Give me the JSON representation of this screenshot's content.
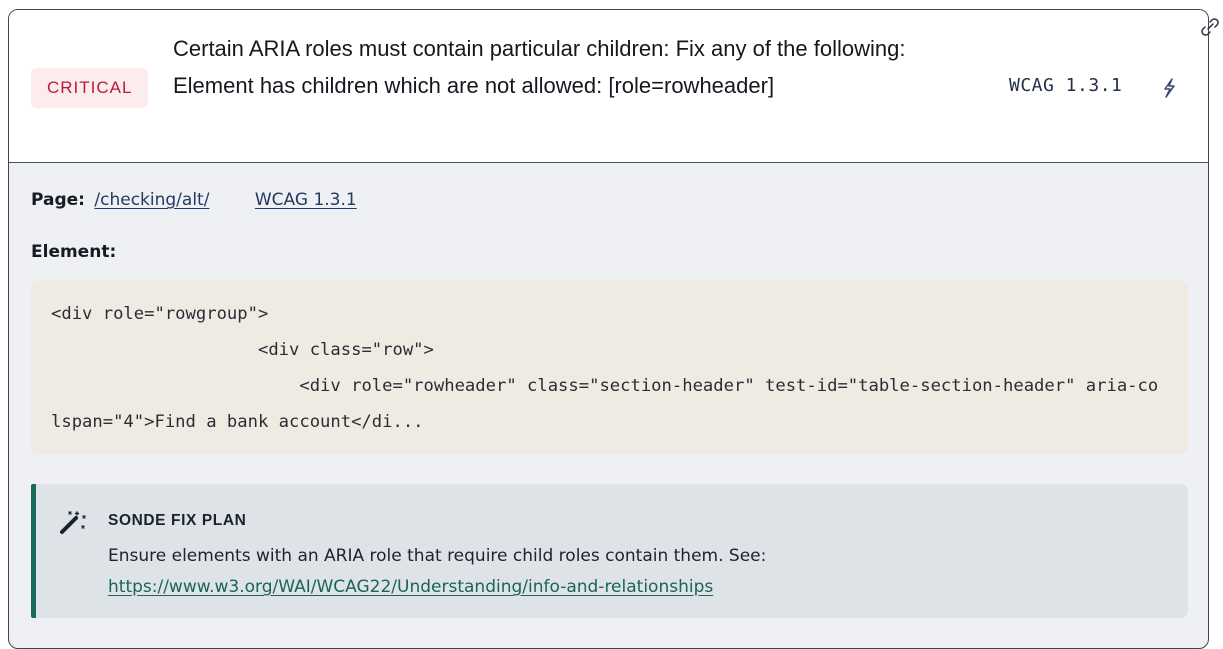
{
  "issue": {
    "severity": "CRITICAL",
    "title": "Certain ARIA roles must contain particular children: Fix any of the following: Element has children which are not allowed: [role=rowheader]",
    "wcag_tag": "WCAG 1.3.1",
    "icons": {
      "action": "bolt-icon",
      "corner": "link-icon"
    }
  },
  "details": {
    "page_label": "Page:",
    "page_link": "/checking/alt/",
    "wcag_link": "WCAG 1.3.1",
    "element_label": "Element:",
    "element_code": "<div role=\"rowgroup\">\n                    <div class=\"row\">\n                        <div role=\"rowheader\" class=\"section-header\" test-id=\"table-section-header\" aria-colspan=\"4\">Find a bank account</di..."
  },
  "fix_plan": {
    "icon": "magic-wand-icon",
    "title": "SONDE FIX PLAN",
    "text": "Ensure elements with an ARIA role that require child roles contain them. See:",
    "link": "https://www.w3.org/WAI/WCAG22/Understanding/info-and-relationships"
  },
  "colors": {
    "severity_text": "#b81d37",
    "severity_bg": "#fcecec",
    "fix_accent": "#1a6b5e",
    "link": "#223a63"
  }
}
